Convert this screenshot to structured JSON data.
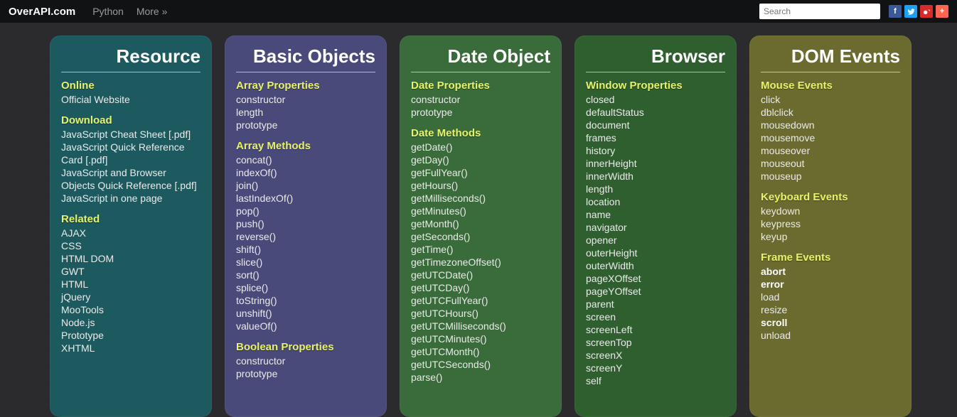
{
  "topbar": {
    "brand": "OverAPI.com",
    "nav": [
      "Python",
      "More »"
    ],
    "search_placeholder": "Search",
    "socials": [
      "f",
      "t",
      "w",
      "+"
    ]
  },
  "cards": [
    {
      "title": "Resource",
      "cls": "c0",
      "sections": [
        {
          "heading": "Online",
          "items": [
            {
              "t": "Official Website"
            }
          ]
        },
        {
          "heading": "Download",
          "items": [
            {
              "t": "JavaScript Cheat Sheet [.pdf]"
            },
            {
              "t": "JavaScript Quick Reference Card [.pdf]"
            },
            {
              "t": "JavaScript and Browser Objects Quick Reference [.pdf]"
            },
            {
              "t": "JavaScript in one page"
            }
          ]
        },
        {
          "heading": "Related",
          "items": [
            {
              "t": "AJAX"
            },
            {
              "t": "CSS"
            },
            {
              "t": "HTML DOM"
            },
            {
              "t": "GWT"
            },
            {
              "t": "HTML"
            },
            {
              "t": "jQuery"
            },
            {
              "t": "MooTools"
            },
            {
              "t": "Node.js"
            },
            {
              "t": "Prototype"
            },
            {
              "t": "XHTML"
            }
          ]
        }
      ]
    },
    {
      "title": "Basic Objects",
      "cls": "c1",
      "sections": [
        {
          "heading": "Array Properties",
          "items": [
            {
              "t": "constructor"
            },
            {
              "t": "length"
            },
            {
              "t": "prototype"
            }
          ]
        },
        {
          "heading": "Array Methods",
          "items": [
            {
              "t": "concat()"
            },
            {
              "t": "indexOf()"
            },
            {
              "t": "join()"
            },
            {
              "t": "lastIndexOf()"
            },
            {
              "t": "pop()"
            },
            {
              "t": "push()"
            },
            {
              "t": "reverse()"
            },
            {
              "t": "shift()"
            },
            {
              "t": "slice()"
            },
            {
              "t": "sort()"
            },
            {
              "t": "splice()"
            },
            {
              "t": "toString()"
            },
            {
              "t": "unshift()"
            },
            {
              "t": "valueOf()"
            }
          ]
        },
        {
          "heading": "Boolean Properties",
          "items": [
            {
              "t": "constructor"
            },
            {
              "t": "prototype"
            }
          ]
        }
      ]
    },
    {
      "title": "Date Object",
      "cls": "c2",
      "sections": [
        {
          "heading": "Date Properties",
          "items": [
            {
              "t": "constructor"
            },
            {
              "t": "prototype"
            }
          ]
        },
        {
          "heading": "Date Methods",
          "items": [
            {
              "t": "getDate()"
            },
            {
              "t": "getDay()"
            },
            {
              "t": "getFullYear()"
            },
            {
              "t": "getHours()"
            },
            {
              "t": "getMilliseconds()"
            },
            {
              "t": "getMinutes()"
            },
            {
              "t": "getMonth()"
            },
            {
              "t": "getSeconds()"
            },
            {
              "t": "getTime()"
            },
            {
              "t": "getTimezoneOffset()"
            },
            {
              "t": "getUTCDate()"
            },
            {
              "t": "getUTCDay()"
            },
            {
              "t": "getUTCFullYear()"
            },
            {
              "t": "getUTCHours()"
            },
            {
              "t": "getUTCMilliseconds()"
            },
            {
              "t": "getUTCMinutes()"
            },
            {
              "t": "getUTCMonth()"
            },
            {
              "t": "getUTCSeconds()"
            },
            {
              "t": "parse()"
            }
          ]
        }
      ]
    },
    {
      "title": "Browser",
      "cls": "c3",
      "sections": [
        {
          "heading": "Window Properties",
          "items": [
            {
              "t": "closed"
            },
            {
              "t": "defaultStatus"
            },
            {
              "t": "document"
            },
            {
              "t": "frames"
            },
            {
              "t": "history"
            },
            {
              "t": "innerHeight"
            },
            {
              "t": "innerWidth"
            },
            {
              "t": "length"
            },
            {
              "t": "location"
            },
            {
              "t": "name"
            },
            {
              "t": "navigator"
            },
            {
              "t": "opener"
            },
            {
              "t": "outerHeight"
            },
            {
              "t": "outerWidth"
            },
            {
              "t": "pageXOffset"
            },
            {
              "t": "pageYOffset"
            },
            {
              "t": "parent"
            },
            {
              "t": "screen"
            },
            {
              "t": "screenLeft"
            },
            {
              "t": "screenTop"
            },
            {
              "t": "screenX"
            },
            {
              "t": "screenY"
            },
            {
              "t": "self"
            }
          ]
        }
      ]
    },
    {
      "title": "DOM Events",
      "cls": "c4",
      "sections": [
        {
          "heading": "Mouse Events",
          "items": [
            {
              "t": "click"
            },
            {
              "t": "dblclick"
            },
            {
              "t": "mousedown"
            },
            {
              "t": "mousemove"
            },
            {
              "t": "mouseover"
            },
            {
              "t": "mouseout"
            },
            {
              "t": "mouseup"
            }
          ]
        },
        {
          "heading": "Keyboard Events",
          "items": [
            {
              "t": "keydown"
            },
            {
              "t": "keypress"
            },
            {
              "t": "keyup"
            }
          ]
        },
        {
          "heading": "Frame Events",
          "items": [
            {
              "t": "abort",
              "b": true
            },
            {
              "t": "error",
              "b": true
            },
            {
              "t": "load"
            },
            {
              "t": "resize"
            },
            {
              "t": "scroll",
              "b": true
            },
            {
              "t": "unload"
            }
          ]
        }
      ]
    }
  ]
}
